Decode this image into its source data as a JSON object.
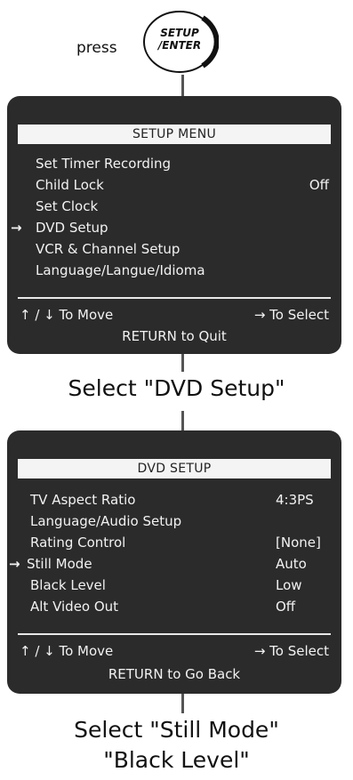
{
  "press_label": "press",
  "button": {
    "line1": "SETUP",
    "line2": "/ENTER"
  },
  "setup_menu": {
    "title": "SETUP MENU",
    "items": [
      {
        "label": "Set Timer Recording",
        "value": ""
      },
      {
        "label": "Child Lock",
        "value": "Off"
      },
      {
        "label": "Set Clock",
        "value": ""
      },
      {
        "label": "DVD Setup",
        "value": ""
      },
      {
        "label": "VCR & Channel Setup",
        "value": ""
      },
      {
        "label": "Language/Langue/Idioma",
        "value": ""
      }
    ],
    "selected_index": 3,
    "footer_move": "↑ / ↓ To Move",
    "footer_select": "→ To Select",
    "footer_return": "RETURN to Quit"
  },
  "caption_1": "Select \"DVD Setup\"",
  "dvd_setup": {
    "title": "DVD SETUP",
    "items": [
      {
        "label": "TV Aspect Ratio",
        "value": "4:3PS"
      },
      {
        "label": "Language/Audio Setup",
        "value": ""
      },
      {
        "label": "Rating Control",
        "value": "[None]"
      },
      {
        "label": "Still Mode",
        "value": "Auto"
      },
      {
        "label": "Black Level",
        "value": "Low"
      },
      {
        "label": "Alt Video Out",
        "value": "Off"
      }
    ],
    "selected_index": 3,
    "footer_move": "↑ / ↓ To Move",
    "footer_select": "→ To Select",
    "footer_return": "RETURN to Go Back"
  },
  "caption_2_line1": "Select \"Still Mode\"",
  "caption_2_line2": "\"Black Level\"",
  "selection_arrow": "→"
}
